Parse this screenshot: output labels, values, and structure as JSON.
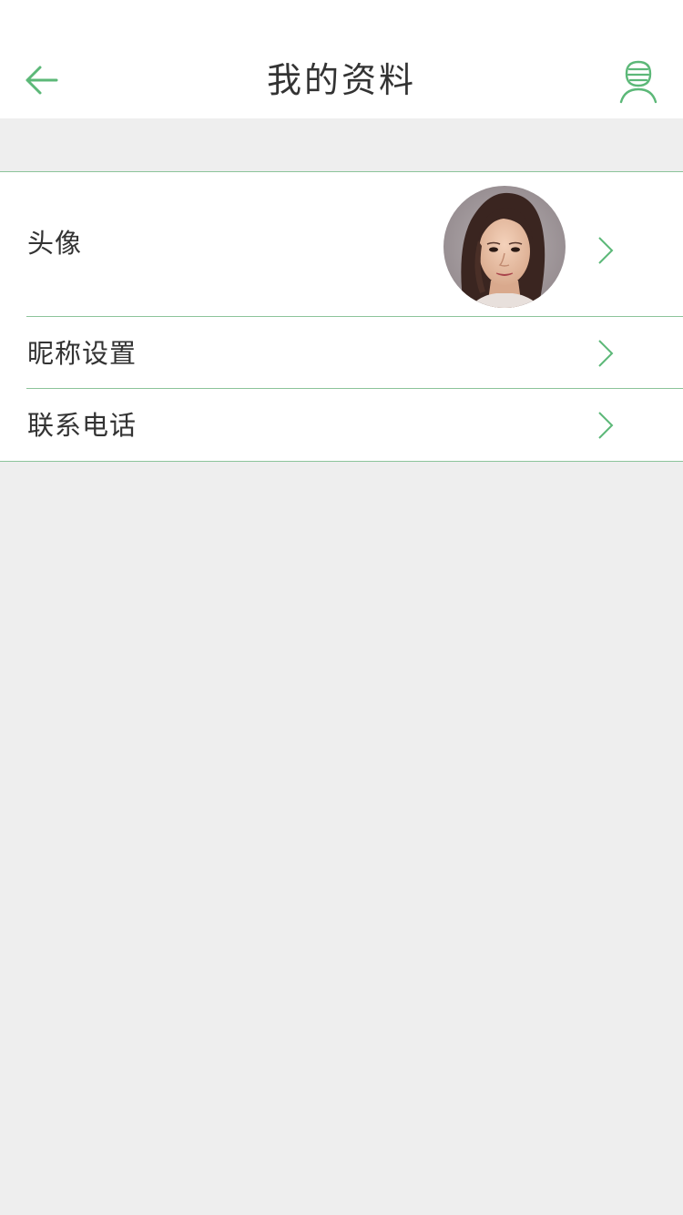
{
  "header": {
    "title": "我的资料",
    "back_icon": "arrow-left-icon",
    "user_icon": "user-profile-icon"
  },
  "rows": [
    {
      "label": "头像",
      "icon": "chevron-right-icon"
    },
    {
      "label": "昵称设置",
      "icon": "chevron-right-icon"
    },
    {
      "label": "联系电话",
      "icon": "chevron-right-icon"
    }
  ],
  "colors": {
    "accent": "#5cb878",
    "divider": "#8cc49a",
    "background": "#eeeeee",
    "text": "#333333"
  }
}
